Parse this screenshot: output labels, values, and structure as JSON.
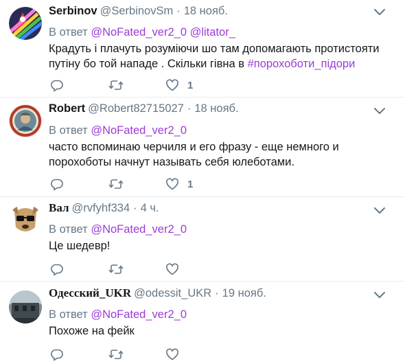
{
  "tweets": [
    {
      "name": "Serbinov",
      "handle": "@SerbinovSm",
      "time": "18 нояб.",
      "reply_prefix": "В ответ",
      "mentions": [
        "@NoFated_ver2_0",
        "@litator_"
      ],
      "text_lines": [
        "Крадуть і плачуть розуміючи шо там допомагають протистояти",
        "путіну бо той нападе . Скільки гівна в "
      ],
      "hashtag": "#порохоботи_підори",
      "likes": "1"
    },
    {
      "name": "Robert",
      "handle": "@Robert82715027",
      "time": "18 нояб.",
      "reply_prefix": "В ответ",
      "mentions": [
        "@NoFated_ver2_0"
      ],
      "text_lines": [
        "часто вспоминаю черчиля и его фразу - еще немного и",
        "порохоботы начнут называть себя юлеботами."
      ],
      "likes": "1"
    },
    {
      "name": "Вал",
      "handle": "@rvfyhf334",
      "time": "4 ч.",
      "reply_prefix": "В ответ",
      "mentions": [
        "@NoFated_ver2_0"
      ],
      "text_lines": [
        "Це шедевр!"
      ],
      "likes": ""
    },
    {
      "name": "Одесский_UKR",
      "handle": "@odessit_UKR",
      "time": "19 нояб.",
      "reply_prefix": "В ответ",
      "mentions": [
        "@NoFated_ver2_0"
      ],
      "text_lines": [
        "Похоже на фейк"
      ],
      "likes": ""
    }
  ],
  "separator": "·",
  "icons": {
    "reply": "reply-icon",
    "retweet": "retweet-icon",
    "like": "heart-icon",
    "menu": "chevron-down-icon"
  },
  "colors": {
    "link": "#9b3bd6",
    "muted": "#657786",
    "text": "#14171a"
  }
}
